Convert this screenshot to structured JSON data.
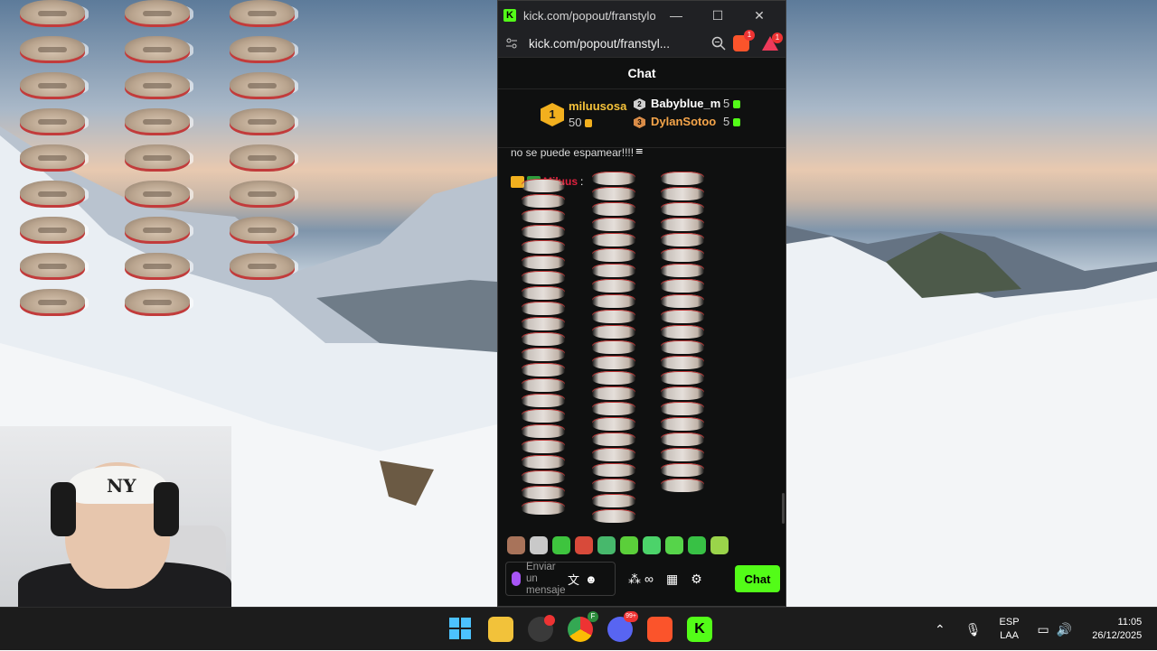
{
  "browser": {
    "tab_title": "kick.com/popout/franstylo/...",
    "address": "kick.com/popout/franstyl...",
    "brave_badge": "1",
    "rewards_badge": "1",
    "minimize_glyph": "—",
    "maximize_glyph": "☐",
    "close_glyph": "✕"
  },
  "chat": {
    "header": "Chat",
    "leaderboard": [
      {
        "rank": "1",
        "name": "miluusosa",
        "value": "50",
        "color": "#f5c23a"
      },
      {
        "rank": "2",
        "name": "Babyblue_m",
        "value": "5",
        "color": "#ffffff"
      },
      {
        "rank": "3",
        "name": "DylanSotoo",
        "value": "5",
        "color": "#f5a54a"
      }
    ],
    "truncated_message": "no se puede espamear!!!!",
    "message_username": "Miluus",
    "message_sep": ":",
    "input_placeholder": "Enviar un mensaje",
    "send_button": "Chat",
    "accent": "#53fc18"
  },
  "taskbar": {
    "language": "ESP",
    "layout": "LAA",
    "time": "11:05",
    "date": "26/12/2025",
    "chrome_badge": "F",
    "discord_badge": "99+"
  },
  "webcam": {
    "cap_text": "NY"
  }
}
